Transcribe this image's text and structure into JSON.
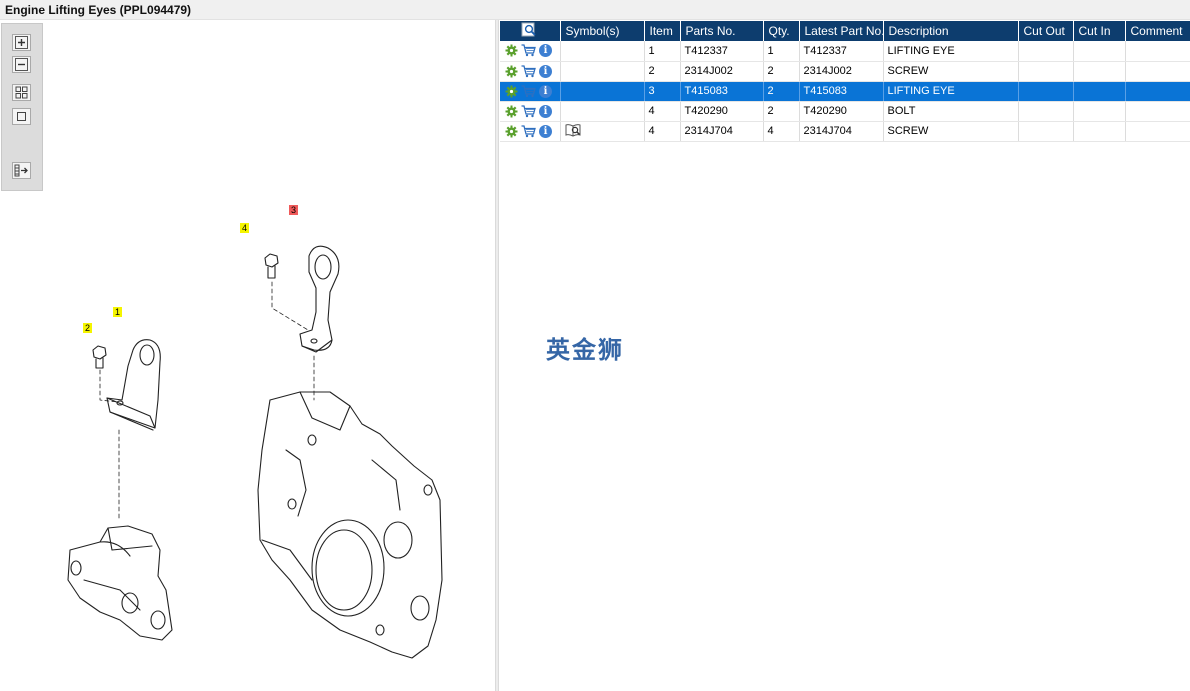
{
  "window": {
    "title": "Engine Lifting Eyes (PPL094479)"
  },
  "toolbox": {
    "zoom_in": "+",
    "zoom_out": "−",
    "fit_all": "fit",
    "fit_page": "page",
    "export": "export"
  },
  "callouts": [
    "1",
    "2",
    "3",
    "4"
  ],
  "table": {
    "columns": [
      "",
      "Symbol(s)",
      "Item",
      "Parts No.",
      "Qty.",
      "Latest Part No.",
      "Description",
      "Cut Out",
      "Cut In",
      "Comment"
    ],
    "rows": [
      {
        "item": "1",
        "part_no": "T412337",
        "qty": "1",
        "latest": "T412337",
        "description": "LIFTING EYE",
        "symbol": "",
        "selected": false
      },
      {
        "item": "2",
        "part_no": "2314J002",
        "qty": "2",
        "latest": "2314J002",
        "description": "SCREW",
        "symbol": "",
        "selected": false
      },
      {
        "item": "3",
        "part_no": "T415083",
        "qty": "2",
        "latest": "T415083",
        "description": "LIFTING EYE",
        "symbol": "",
        "selected": true
      },
      {
        "item": "4",
        "part_no": "T420290",
        "qty": "2",
        "latest": "T420290",
        "description": "BOLT",
        "symbol": "",
        "selected": false
      },
      {
        "item": "4",
        "part_no": "2314J704",
        "qty": "4",
        "latest": "2314J704",
        "description": "SCREW",
        "symbol": "book-magnifier-icon",
        "selected": false
      }
    ]
  },
  "watermark": "英金狮",
  "colors": {
    "header_bg": "#0d3d6e",
    "selected_row": "#0a74d6",
    "callout_yellow": "#f5f500",
    "callout_red": "#f05a5a"
  }
}
